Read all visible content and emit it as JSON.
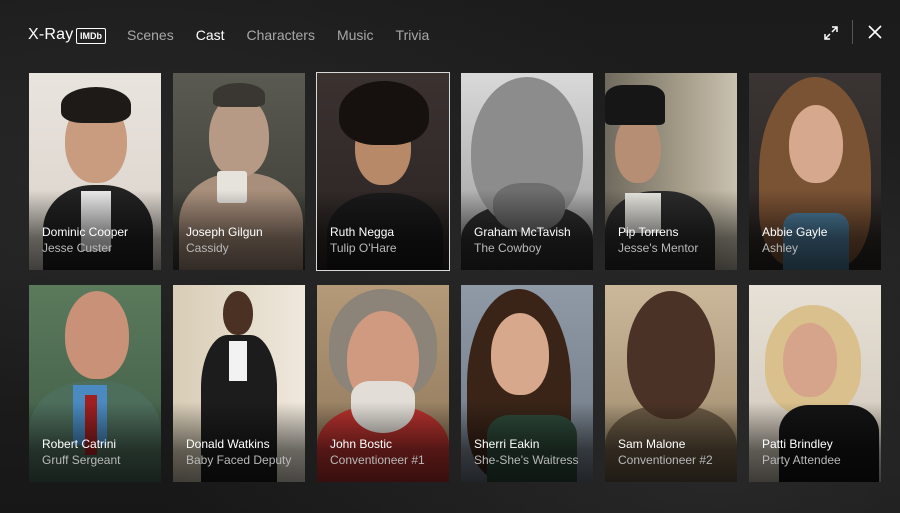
{
  "header": {
    "title": "X-Ray",
    "badge": "IMDb",
    "tabs": [
      {
        "label": "Scenes",
        "active": false
      },
      {
        "label": "Cast",
        "active": true
      },
      {
        "label": "Characters",
        "active": false
      },
      {
        "label": "Music",
        "active": false
      },
      {
        "label": "Trivia",
        "active": false
      }
    ],
    "icons": {
      "expand": "expand-icon",
      "close": "close-icon"
    }
  },
  "cast": [
    {
      "actor": "Dominic Cooper",
      "role": "Jesse Custer"
    },
    {
      "actor": "Joseph Gilgun",
      "role": "Cassidy"
    },
    {
      "actor": "Ruth Negga",
      "role": "Tulip O'Hare"
    },
    {
      "actor": "Graham McTavish",
      "role": "The Cowboy"
    },
    {
      "actor": "Pip Torrens",
      "role": "Jesse's Mentor"
    },
    {
      "actor": "Abbie Gayle",
      "role": "Ashley"
    },
    {
      "actor": "Robert Catrini",
      "role": "Gruff Sergeant"
    },
    {
      "actor": "Donald Watkins",
      "role": "Baby Faced Deputy"
    },
    {
      "actor": "John Bostic",
      "role": "Conventioneer #1"
    },
    {
      "actor": "Sherri Eakin",
      "role": "She-She's Waitress"
    },
    {
      "actor": "Sam Malone",
      "role": "Conventioneer #2"
    },
    {
      "actor": "Patti Brindley",
      "role": "Party Attendee"
    }
  ],
  "colors": {
    "active_tab": "#ffffff",
    "inactive_tab": "#a8a8a8",
    "role_text": "#b9b9b9"
  }
}
